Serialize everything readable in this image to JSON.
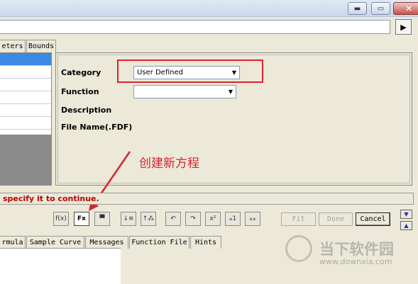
{
  "window": {
    "minimize_glyph": "▬",
    "restore_glyph": "▭",
    "close_glyph": "✕"
  },
  "path_arrow": "▶",
  "top_tabs": [
    "eters",
    "Bounds"
  ],
  "form": {
    "category_label": "Category",
    "category_value": "User Defined",
    "function_label": "Function",
    "function_value": "",
    "description_label": "Description",
    "filename_label": "File Name(.FDF)",
    "dropdown_arrow": "▼"
  },
  "annotation": {
    "text": "创建新方程",
    "color": "#d9232d"
  },
  "status_message": "specify it to continue.",
  "toolbar_icons": [
    {
      "name": "formula-edit-icon",
      "glyph": "f(x)"
    },
    {
      "name": "new-function-icon",
      "glyph": "Fx"
    },
    {
      "name": "save-icon",
      "glyph": "▀"
    },
    {
      "name": "sort-down-icon",
      "glyph": "↓≡"
    },
    {
      "name": "tree-up-icon",
      "glyph": "↑⁂"
    },
    {
      "name": "undo-icon",
      "glyph": "↶"
    },
    {
      "name": "redo-icon",
      "glyph": "↷"
    },
    {
      "name": "chi-square-icon",
      "glyph": "x²"
    },
    {
      "name": "fit-one-iteration-icon",
      "glyph": "⁎1"
    },
    {
      "name": "fit-many-iterations-icon",
      "glyph": "⁎⁎"
    }
  ],
  "buttons": {
    "fit": "Fit",
    "done": "Done",
    "cancel": "Cancel"
  },
  "scroll": {
    "down": "▼",
    "up": "▲"
  },
  "bottom_tabs": [
    "rmula",
    "Sample Curve",
    "Messages",
    "Function File",
    "Hints"
  ],
  "watermark": {
    "brand": "当下软件园",
    "url": "www.downxia.com"
  }
}
